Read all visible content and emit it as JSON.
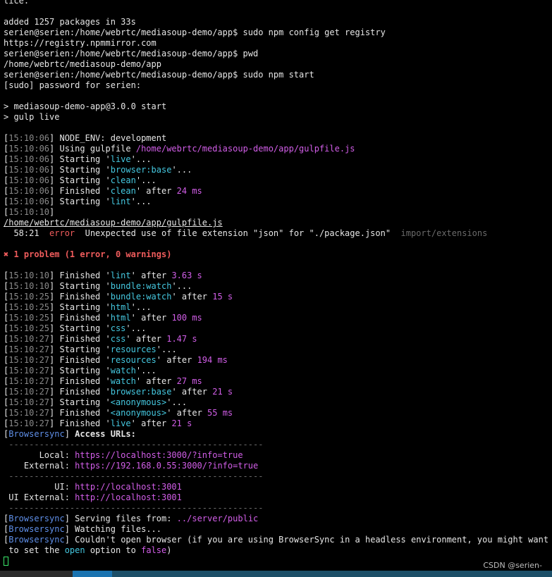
{
  "terminal": {
    "lines": [
      [
        {
          "t": "tice."
        }
      ],
      [
        {
          "t": ""
        }
      ],
      [
        {
          "t": "added 1257 packages in 33s"
        }
      ],
      [
        {
          "t": "serien@serien:/home/webrtc/mediasoup-demo/app$ sudo npm config get registry"
        }
      ],
      [
        {
          "t": "https://registry.npmmirror.com"
        }
      ],
      [
        {
          "t": "serien@serien:/home/webrtc/mediasoup-demo/app$ pwd"
        }
      ],
      [
        {
          "t": "/home/webrtc/mediasoup-demo/app"
        }
      ],
      [
        {
          "t": "serien@serien:/home/webrtc/mediasoup-demo/app$ sudo npm start"
        }
      ],
      [
        {
          "t": "[sudo] password for serien:"
        }
      ],
      [
        {
          "t": ""
        }
      ],
      [
        {
          "t": "> mediasoup-demo-app@3.0.0 start"
        }
      ],
      [
        {
          "t": "> gulp live"
        }
      ],
      [
        {
          "t": ""
        }
      ],
      [
        {
          "t": "["
        },
        {
          "t": "15:10:06",
          "c": "ts"
        },
        {
          "t": "] NODE_ENV: development"
        }
      ],
      [
        {
          "t": "["
        },
        {
          "t": "15:10:06",
          "c": "ts"
        },
        {
          "t": "] Using gulpfile "
        },
        {
          "t": "/home/webrtc/mediasoup-demo/app/gulpfile.js",
          "c": "mag"
        }
      ],
      [
        {
          "t": "["
        },
        {
          "t": "15:10:06",
          "c": "ts"
        },
        {
          "t": "] Starting '"
        },
        {
          "t": "live",
          "c": "cyan"
        },
        {
          "t": "'..."
        }
      ],
      [
        {
          "t": "["
        },
        {
          "t": "15:10:06",
          "c": "ts"
        },
        {
          "t": "] Starting '"
        },
        {
          "t": "browser:base",
          "c": "cyan"
        },
        {
          "t": "'..."
        }
      ],
      [
        {
          "t": "["
        },
        {
          "t": "15:10:06",
          "c": "ts"
        },
        {
          "t": "] Starting '"
        },
        {
          "t": "clean",
          "c": "cyan"
        },
        {
          "t": "'..."
        }
      ],
      [
        {
          "t": "["
        },
        {
          "t": "15:10:06",
          "c": "ts"
        },
        {
          "t": "] Finished '"
        },
        {
          "t": "clean",
          "c": "cyan"
        },
        {
          "t": "' after "
        },
        {
          "t": "24 ms",
          "c": "mag"
        }
      ],
      [
        {
          "t": "["
        },
        {
          "t": "15:10:06",
          "c": "ts"
        },
        {
          "t": "] Starting '"
        },
        {
          "t": "lint",
          "c": "cyan"
        },
        {
          "t": "'..."
        }
      ],
      [
        {
          "t": "["
        },
        {
          "t": "15:10:10",
          "c": "ts"
        },
        {
          "t": "]"
        }
      ],
      [
        {
          "t": "/home/webrtc/mediasoup-demo/app/gulpfile.js",
          "c": "und"
        }
      ],
      [
        {
          "t": "  58:21  "
        },
        {
          "t": "error",
          "c": "red"
        },
        {
          "t": "  Unexpected use of file extension \"json\" for \"./package.json\"  "
        },
        {
          "t": "import/extensions",
          "c": "dim"
        }
      ],
      [
        {
          "t": ""
        }
      ],
      [
        {
          "t": "✖ 1 problem (1 error, 0 warnings)",
          "c": "redb"
        }
      ],
      [
        {
          "t": ""
        }
      ],
      [
        {
          "t": "["
        },
        {
          "t": "15:10:10",
          "c": "ts"
        },
        {
          "t": "] Finished '"
        },
        {
          "t": "lint",
          "c": "cyan"
        },
        {
          "t": "' after "
        },
        {
          "t": "3.63 s",
          "c": "mag"
        }
      ],
      [
        {
          "t": "["
        },
        {
          "t": "15:10:10",
          "c": "ts"
        },
        {
          "t": "] Starting '"
        },
        {
          "t": "bundle:watch",
          "c": "cyan"
        },
        {
          "t": "'..."
        }
      ],
      [
        {
          "t": "["
        },
        {
          "t": "15:10:25",
          "c": "ts"
        },
        {
          "t": "] Finished '"
        },
        {
          "t": "bundle:watch",
          "c": "cyan"
        },
        {
          "t": "' after "
        },
        {
          "t": "15 s",
          "c": "mag"
        }
      ],
      [
        {
          "t": "["
        },
        {
          "t": "15:10:25",
          "c": "ts"
        },
        {
          "t": "] Starting '"
        },
        {
          "t": "html",
          "c": "cyan"
        },
        {
          "t": "'..."
        }
      ],
      [
        {
          "t": "["
        },
        {
          "t": "15:10:25",
          "c": "ts"
        },
        {
          "t": "] Finished '"
        },
        {
          "t": "html",
          "c": "cyan"
        },
        {
          "t": "' after "
        },
        {
          "t": "100 ms",
          "c": "mag"
        }
      ],
      [
        {
          "t": "["
        },
        {
          "t": "15:10:25",
          "c": "ts"
        },
        {
          "t": "] Starting '"
        },
        {
          "t": "css",
          "c": "cyan"
        },
        {
          "t": "'..."
        }
      ],
      [
        {
          "t": "["
        },
        {
          "t": "15:10:27",
          "c": "ts"
        },
        {
          "t": "] Finished '"
        },
        {
          "t": "css",
          "c": "cyan"
        },
        {
          "t": "' after "
        },
        {
          "t": "1.47 s",
          "c": "mag"
        }
      ],
      [
        {
          "t": "["
        },
        {
          "t": "15:10:27",
          "c": "ts"
        },
        {
          "t": "] Starting '"
        },
        {
          "t": "resources",
          "c": "cyan"
        },
        {
          "t": "'..."
        }
      ],
      [
        {
          "t": "["
        },
        {
          "t": "15:10:27",
          "c": "ts"
        },
        {
          "t": "] Finished '"
        },
        {
          "t": "resources",
          "c": "cyan"
        },
        {
          "t": "' after "
        },
        {
          "t": "194 ms",
          "c": "mag"
        }
      ],
      [
        {
          "t": "["
        },
        {
          "t": "15:10:27",
          "c": "ts"
        },
        {
          "t": "] Starting '"
        },
        {
          "t": "watch",
          "c": "cyan"
        },
        {
          "t": "'..."
        }
      ],
      [
        {
          "t": "["
        },
        {
          "t": "15:10:27",
          "c": "ts"
        },
        {
          "t": "] Finished '"
        },
        {
          "t": "watch",
          "c": "cyan"
        },
        {
          "t": "' after "
        },
        {
          "t": "27 ms",
          "c": "mag"
        }
      ],
      [
        {
          "t": "["
        },
        {
          "t": "15:10:27",
          "c": "ts"
        },
        {
          "t": "] Finished '"
        },
        {
          "t": "browser:base",
          "c": "cyan"
        },
        {
          "t": "' after "
        },
        {
          "t": "21 s",
          "c": "mag"
        }
      ],
      [
        {
          "t": "["
        },
        {
          "t": "15:10:27",
          "c": "ts"
        },
        {
          "t": "] Starting '"
        },
        {
          "t": "<anonymous>",
          "c": "cyan"
        },
        {
          "t": "'..."
        }
      ],
      [
        {
          "t": "["
        },
        {
          "t": "15:10:27",
          "c": "ts"
        },
        {
          "t": "] Finished '"
        },
        {
          "t": "<anonymous>",
          "c": "cyan"
        },
        {
          "t": "' after "
        },
        {
          "t": "55 ms",
          "c": "mag"
        }
      ],
      [
        {
          "t": "["
        },
        {
          "t": "15:10:27",
          "c": "ts"
        },
        {
          "t": "] Finished '"
        },
        {
          "t": "live",
          "c": "cyan"
        },
        {
          "t": "' after "
        },
        {
          "t": "21 s",
          "c": "mag"
        }
      ],
      [
        {
          "t": "["
        },
        {
          "t": "Browsersync",
          "c": "blue"
        },
        {
          "t": "] "
        },
        {
          "t": "Access URLs:",
          "c": "bold"
        }
      ],
      [
        {
          "t": " --------------------------------------------------",
          "c": "dim"
        }
      ],
      [
        {
          "t": "       Local: "
        },
        {
          "t": "https://localhost:3000/?info=true",
          "c": "mag"
        }
      ],
      [
        {
          "t": "    External: "
        },
        {
          "t": "https://192.168.0.55:3000/?info=true",
          "c": "mag"
        }
      ],
      [
        {
          "t": " --------------------------------------------------",
          "c": "dim"
        }
      ],
      [
        {
          "t": "          UI: "
        },
        {
          "t": "http://localhost:3001",
          "c": "mag"
        }
      ],
      [
        {
          "t": " UI External: "
        },
        {
          "t": "http://localhost:3001",
          "c": "mag"
        }
      ],
      [
        {
          "t": " --------------------------------------------------",
          "c": "dim"
        }
      ],
      [
        {
          "t": "["
        },
        {
          "t": "Browsersync",
          "c": "blue"
        },
        {
          "t": "] Serving files from: "
        },
        {
          "t": "../server/public",
          "c": "mag"
        }
      ],
      [
        {
          "t": "["
        },
        {
          "t": "Browsersync",
          "c": "blue"
        },
        {
          "t": "] Watching files..."
        }
      ],
      [
        {
          "t": "["
        },
        {
          "t": "Browsersync",
          "c": "blue"
        },
        {
          "t": "] Couldn't open browser (if you are using BrowserSync in a headless environment, you might want"
        }
      ],
      [
        {
          "t": " to set the "
        },
        {
          "t": "open",
          "c": "cyan"
        },
        {
          "t": " option to "
        },
        {
          "t": "false",
          "c": "mag"
        },
        {
          "t": ")"
        }
      ]
    ]
  },
  "watermark": "CSDN @serien-",
  "colors": {
    "background": "#000000",
    "timestamp": "#8a8a8a",
    "task_name": "#45c8e0",
    "value": "#d25ee8",
    "error": "#ef5c5c",
    "browsersync": "#5f8fe8",
    "cursor": "#3ae86a",
    "taskbar": "#1c4f68"
  }
}
